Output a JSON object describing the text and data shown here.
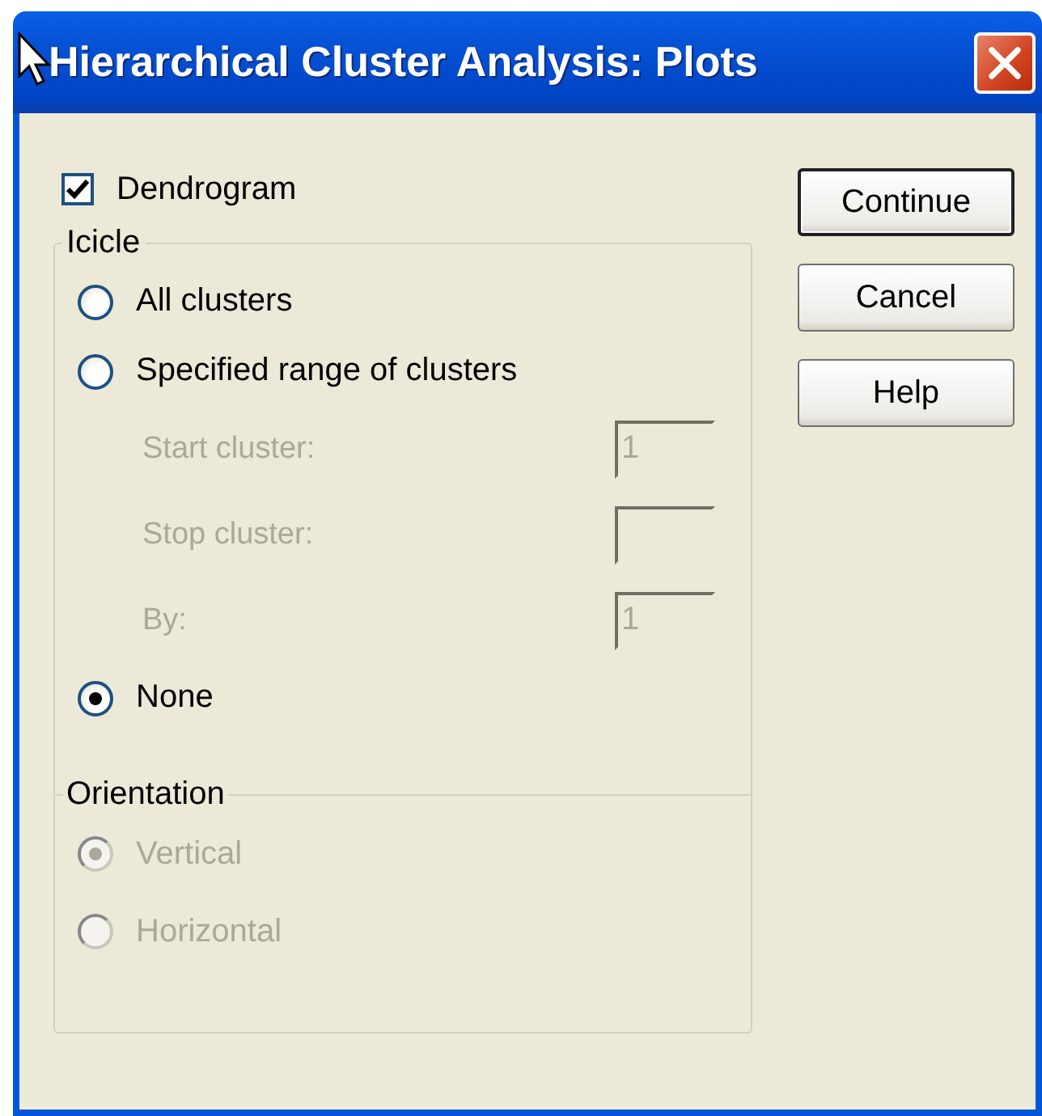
{
  "window": {
    "title": "Hierarchical Cluster Analysis: Plots"
  },
  "dendrogram": {
    "label": "Dendrogram",
    "checked": true
  },
  "icicle": {
    "title": "Icicle",
    "options": [
      {
        "label": "All clusters",
        "selected": false,
        "disabled": false
      },
      {
        "label": "Specified range of clusters",
        "selected": false,
        "disabled": false
      }
    ],
    "range_fields": [
      {
        "label": "Start cluster:",
        "value": "1",
        "disabled": true
      },
      {
        "label": "Stop cluster:",
        "disabled": true
      },
      {
        "label": "By:",
        "value": "1",
        "disabled": true
      }
    ],
    "none_option": {
      "label": "None",
      "selected": true,
      "disabled": false
    },
    "orientation": {
      "title": "Orientation",
      "options": [
        {
          "label": "Vertical",
          "selected": true,
          "disabled": true
        },
        {
          "label": "Horizontal",
          "selected": false,
          "disabled": true
        }
      ]
    }
  },
  "buttons": [
    {
      "label": "Continue",
      "default": true
    },
    {
      "label": "Cancel",
      "default": false
    },
    {
      "label": "Help",
      "default": false
    }
  ]
}
